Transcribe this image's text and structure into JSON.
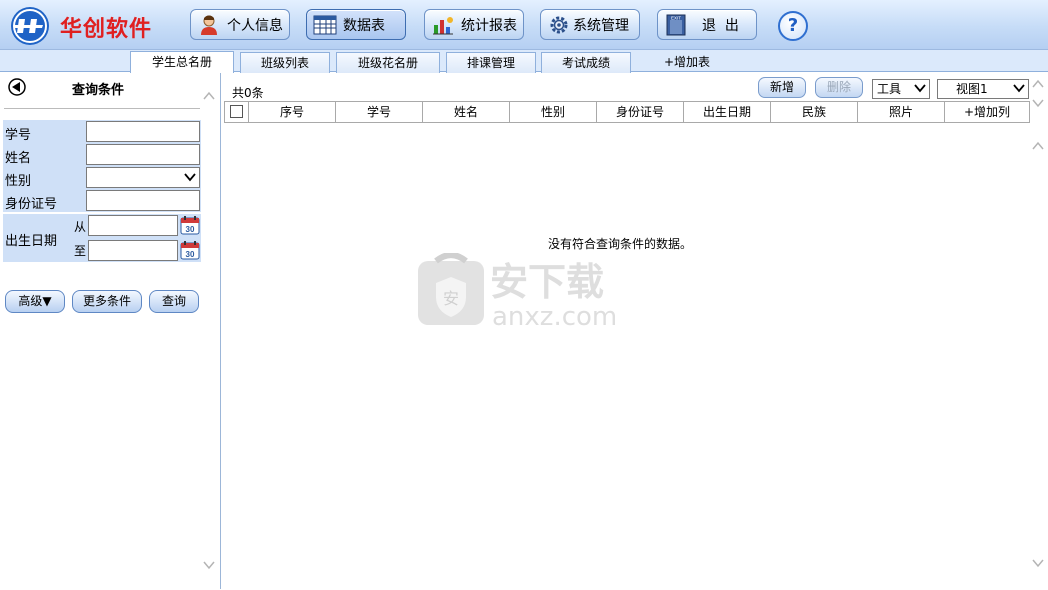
{
  "header": {
    "brand": "华创软件",
    "buttons": {
      "profile": "个人信息",
      "datatable": "数据表",
      "reports": "统计报表",
      "system": "系统管理",
      "exit": "退  出",
      "exit_badge": "EXIT"
    },
    "help": "?"
  },
  "tabs": [
    "学生总名册",
    "班级列表",
    "班级花名册",
    "排课管理",
    "考试成绩"
  ],
  "add_table": "+增加表",
  "query": {
    "title": "查询条件",
    "fields": {
      "student_id": "学号",
      "name": "姓名",
      "gender": "性别",
      "id_number": "身份证号",
      "birth_date": "出生日期",
      "from": "从",
      "to": "至"
    },
    "calendar_day": "30",
    "buttons": {
      "advanced": "高级▼",
      "more": "更多条件",
      "search": "查询"
    }
  },
  "results": {
    "count": "共0条",
    "actions": {
      "add": "新增",
      "delete": "删除"
    },
    "tools": "工具",
    "view": "视图1",
    "columns": [
      "序号",
      "学号",
      "姓名",
      "性别",
      "身份证号",
      "出生日期",
      "民族",
      "照片",
      "+增加列"
    ],
    "empty_message": "没有符合查询条件的数据。"
  },
  "watermark": {
    "cn": "安下载",
    "en": "anxz.com",
    "badge": "安"
  }
}
